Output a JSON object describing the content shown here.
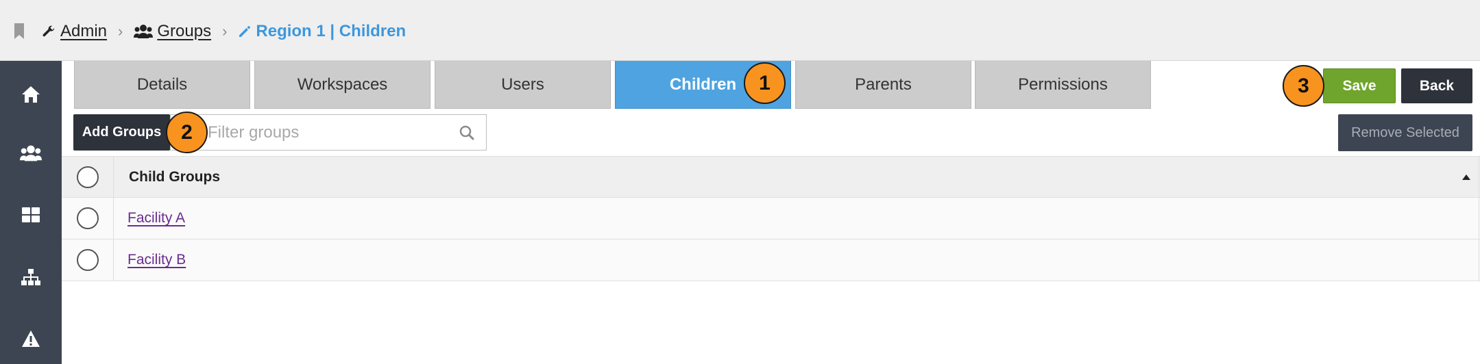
{
  "breadcrumb": {
    "items": [
      {
        "label": "Admin",
        "icon": "wrench-icon"
      },
      {
        "label": "Groups",
        "icon": "users-icon"
      },
      {
        "label": "Region 1 | Children",
        "icon": "pencil-icon"
      }
    ],
    "separator": "›"
  },
  "sidebar": {
    "items": [
      {
        "icon": "home-icon"
      },
      {
        "icon": "users-icon"
      },
      {
        "icon": "grid-icon"
      },
      {
        "icon": "sitemap-icon"
      },
      {
        "icon": "warning-icon"
      }
    ]
  },
  "tabs": [
    {
      "label": "Details"
    },
    {
      "label": "Workspaces"
    },
    {
      "label": "Users"
    },
    {
      "label": "Children",
      "active": true
    },
    {
      "label": "Parents"
    },
    {
      "label": "Permissions"
    }
  ],
  "actions": {
    "save_label": "Save",
    "back_label": "Back",
    "remove_label": "Remove Selected",
    "add_label": "Add Groups"
  },
  "filter": {
    "placeholder": "Filter groups",
    "value": ""
  },
  "table": {
    "header": "Child Groups",
    "rows": [
      {
        "name": "Facility A"
      },
      {
        "name": "Facility B"
      }
    ]
  },
  "callouts": [
    "1",
    "2",
    "3"
  ],
  "colors": {
    "accent": "#4ea3e0",
    "save": "#6fa52c",
    "sidebar": "#3e4552",
    "callout": "#f7931e",
    "link": "#6a2d8c"
  }
}
